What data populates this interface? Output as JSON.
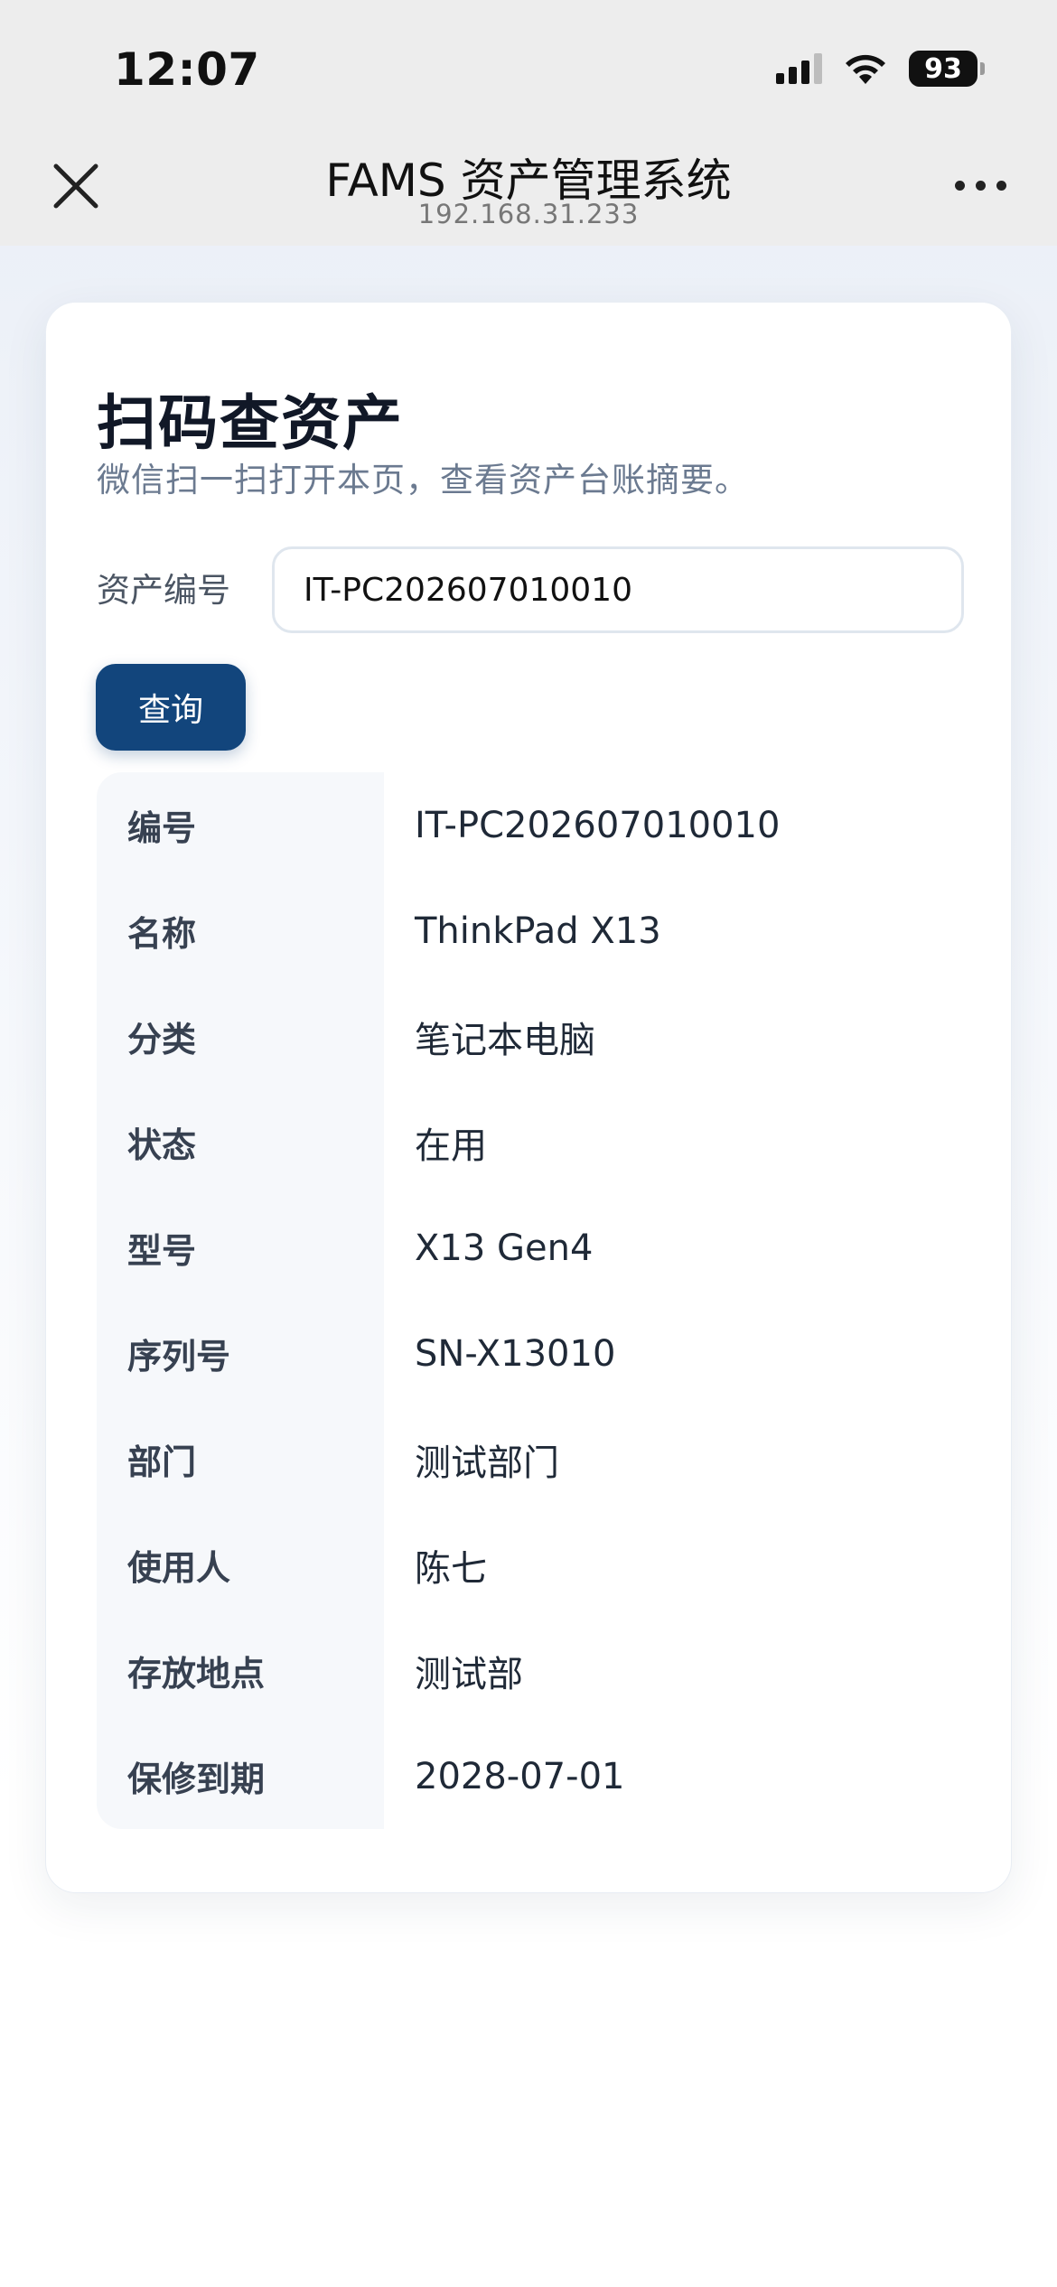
{
  "status_bar": {
    "time": "12:07",
    "battery": "93",
    "icons": [
      "signal-icon",
      "wifi-icon",
      "battery-icon"
    ]
  },
  "nav": {
    "title": "FAMS 资产管理系统",
    "subtitle": "192.168.31.233",
    "icons": [
      "close-icon",
      "more-icon"
    ]
  },
  "card": {
    "title": "扫码查资产",
    "subtitle": "微信扫一扫打开本页，查看资产台账摘要。",
    "field_label": "资产编号",
    "input_value": "IT-PC202607010010",
    "query_label": "查询"
  },
  "details": [
    {
      "key": "编号",
      "value": "IT-PC202607010010"
    },
    {
      "key": "名称",
      "value": "ThinkPad X13"
    },
    {
      "key": "分类",
      "value": "笔记本电脑"
    },
    {
      "key": "状态",
      "value": "在用"
    },
    {
      "key": "型号",
      "value": "X13 Gen4"
    },
    {
      "key": "序列号",
      "value": "SN-X13010"
    },
    {
      "key": "部门",
      "value": "测试部门"
    },
    {
      "key": "使用人",
      "value": "陈七"
    },
    {
      "key": "存放地点",
      "value": "测试部"
    },
    {
      "key": "保修到期",
      "value": "2028-07-01"
    }
  ],
  "colors": {
    "accent": "#12457c",
    "header_bg": "#ededed",
    "key_column_bg": "#f6f8fb"
  }
}
